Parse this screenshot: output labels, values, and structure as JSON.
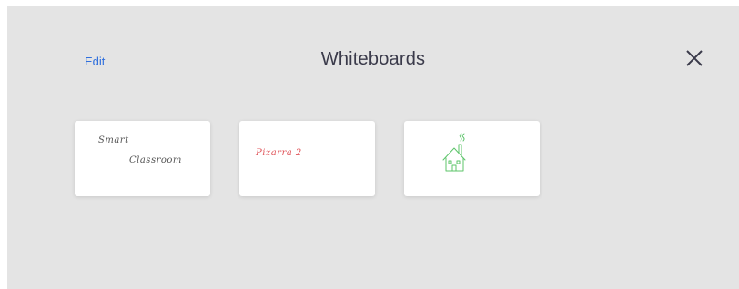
{
  "header": {
    "edit_label": "Edit",
    "title": "Whiteboards",
    "close_icon": "close-icon"
  },
  "boards": [
    {
      "line1": "Smart",
      "line2": "Classroom",
      "ink_color": "#555555"
    },
    {
      "line1": "Pizarra 2",
      "ink_color": "#e0565b"
    },
    {
      "drawing": "house-sketch",
      "ink_color": "#5cc46a"
    }
  ],
  "colors": {
    "background": "#e4e4e4",
    "accent": "#2f6fdd",
    "title_text": "#3a3a4a"
  }
}
